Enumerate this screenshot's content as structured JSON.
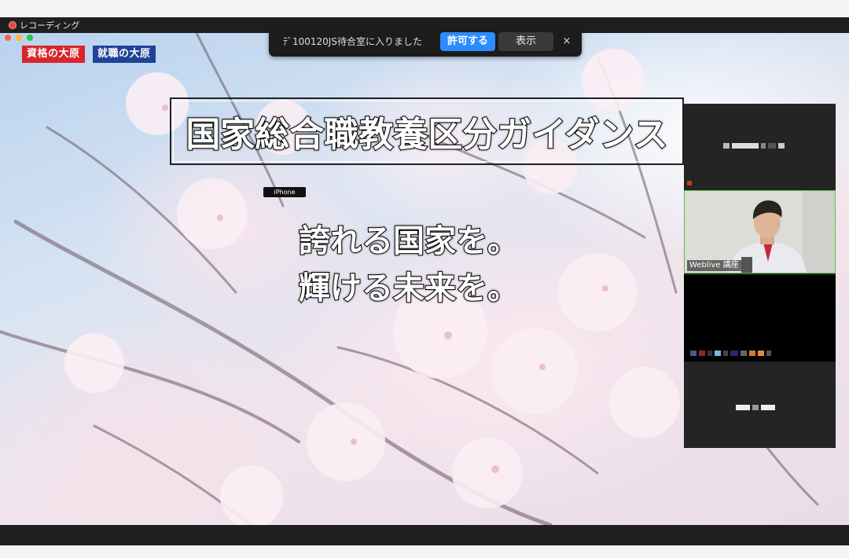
{
  "window": {
    "recording_label": "レコーディング"
  },
  "notification": {
    "text": "ﾃﾞ100120JS待合室に入りました",
    "allow_button": "許可する",
    "show_button": "表示",
    "close_button": "×"
  },
  "slide": {
    "logos": [
      "資格の大原",
      "就職の大原"
    ],
    "title": "国家総合職教養区分ガイダンス",
    "device_tag": "iPhone",
    "slogan_line1": "誇れる国家を。",
    "slogan_line2": "輝ける未来を。"
  },
  "participants": {
    "active_speaker_label": "Weblive 講座"
  },
  "colors": {
    "allow_button": "#2d8cff",
    "active_tile_border": "#58c33a",
    "logo_red": "#d8262b",
    "logo_blue": "#1f4496"
  },
  "icons": [
    "record-icon",
    "close-icon"
  ]
}
